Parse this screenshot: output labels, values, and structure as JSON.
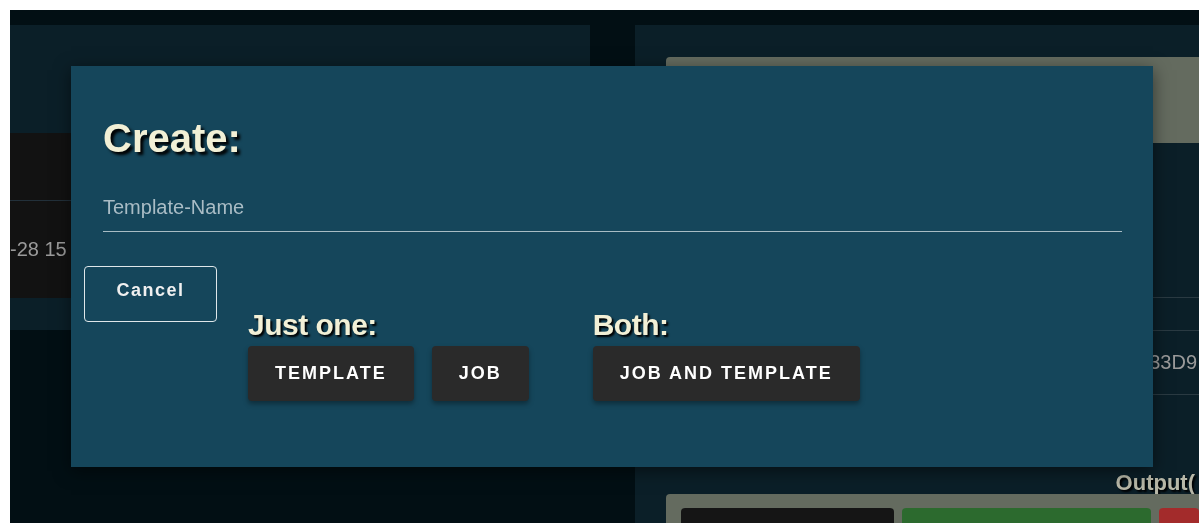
{
  "background": {
    "left_row_text": "-28 15",
    "right_row_text": "33D9",
    "section_heading": "Output(",
    "bottom_buttons": [
      {
        "color": "#151515"
      },
      {
        "color": "#2c6a2e"
      },
      {
        "color": "#a32b2b"
      }
    ]
  },
  "dialog": {
    "title": "Create:",
    "name_field": {
      "placeholder": "Template-Name"
    },
    "cancel_button": "Cancel",
    "groups": [
      {
        "heading": "Just one:",
        "buttons": [
          "TEMPLATE",
          "JOB"
        ]
      },
      {
        "heading": "Both:",
        "buttons": [
          "JOB AND TEMPLATE"
        ]
      }
    ]
  }
}
